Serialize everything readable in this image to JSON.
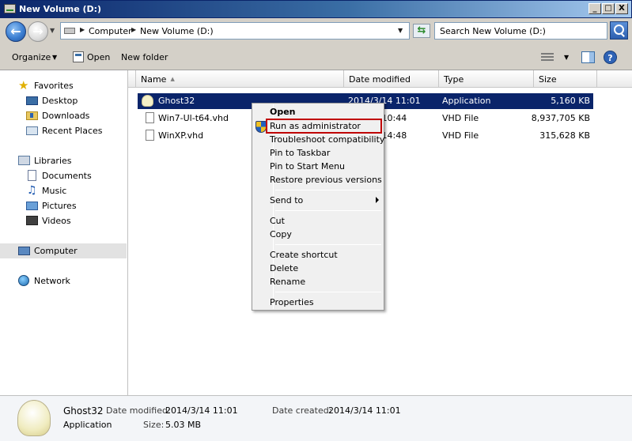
{
  "window": {
    "title": "New Volume (D:)",
    "minimize": "_",
    "maximize": "□",
    "close": "X"
  },
  "address": {
    "crumbs": [
      "Computer",
      "New Volume (D:)"
    ],
    "search_placeholder": "Search New Volume (D:)"
  },
  "toolbar": {
    "organize": "Organize",
    "open": "Open",
    "new_folder": "New folder"
  },
  "nav": {
    "favorites": "Favorites",
    "favorites_items": [
      "Desktop",
      "Downloads",
      "Recent Places"
    ],
    "libraries": "Libraries",
    "libraries_items": [
      "Documents",
      "Music",
      "Pictures",
      "Videos"
    ],
    "computer": "Computer",
    "network": "Network"
  },
  "columns": {
    "name": "Name",
    "date": "Date modified",
    "type": "Type",
    "size": "Size"
  },
  "files": [
    {
      "name": "Ghost32",
      "date": "2014/3/14 11:01",
      "type": "Application",
      "size": "5,160 KB"
    },
    {
      "name": "Win7-Ul-t64.vhd",
      "date": "4 10:44",
      "type": "VHD File",
      "size": "8,937,705 KB"
    },
    {
      "name": "WinXP.vhd",
      "date": "2 14:48",
      "type": "VHD File",
      "size": "315,628 KB"
    }
  ],
  "context_menu": {
    "open": "Open",
    "run_as_admin": "Run as administrator",
    "troubleshoot": "Troubleshoot compatibility",
    "pin_taskbar": "Pin to Taskbar",
    "pin_start": "Pin to Start Menu",
    "restore": "Restore previous versions",
    "send_to": "Send to",
    "cut": "Cut",
    "copy": "Copy",
    "create_shortcut": "Create shortcut",
    "delete": "Delete",
    "rename": "Rename",
    "properties": "Properties"
  },
  "details": {
    "name": "Ghost32",
    "date_modified_label": "Date modified:",
    "date_modified": "2014/3/14 11:01",
    "date_created_label": "Date created:",
    "date_created": "2014/3/14 11:01",
    "type": "Application",
    "size_label": "Size:",
    "size": "5.03 MB"
  },
  "colors": {
    "title_bar": "#0a246a",
    "selection": "#0a246a",
    "admin_highlight": "#c00000"
  }
}
